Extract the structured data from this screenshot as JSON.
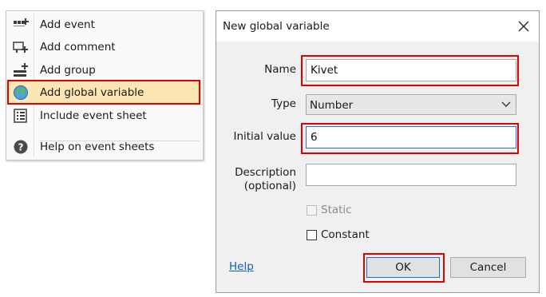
{
  "context_menu": {
    "items": [
      {
        "label": "Add event",
        "icon": "add-event-icon"
      },
      {
        "label": "Add comment",
        "icon": "add-comment-icon"
      },
      {
        "label": "Add group",
        "icon": "add-group-icon"
      },
      {
        "label": "Add global variable",
        "icon": "globe-icon"
      },
      {
        "label": "Include event sheet",
        "icon": "include-sheet-icon"
      },
      {
        "label": "Help on event sheets",
        "icon": "help-icon"
      }
    ],
    "highlighted_item": "Add global variable"
  },
  "dialog": {
    "title": "New global variable",
    "name_label": "Name",
    "name_value": "Kivet",
    "type_label": "Type",
    "type_value": "Number",
    "initial_label": "Initial value",
    "initial_value": "6",
    "description_label_line1": "Description",
    "description_label_line2": "(optional)",
    "description_value": "",
    "static_label": "Static",
    "static_checked": false,
    "static_enabled": false,
    "constant_label": "Constant",
    "constant_checked": false,
    "help_label": "Help",
    "ok_label": "OK",
    "cancel_label": "Cancel"
  },
  "colors": {
    "highlight_fill": "#fce6b3",
    "annotation_red": "#e00000",
    "link_blue": "#0a5fbf",
    "focus_blue": "#2e6fd6"
  }
}
